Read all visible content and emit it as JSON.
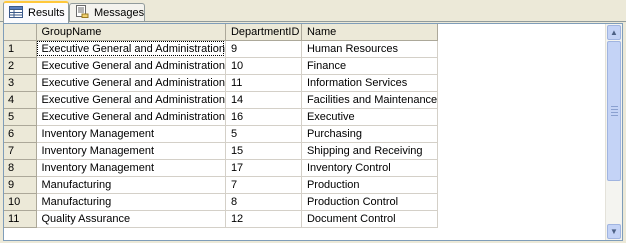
{
  "tabs": [
    {
      "label": "Results",
      "icon": "grid-icon",
      "active": true
    },
    {
      "label": "Messages",
      "icon": "document-icon",
      "active": false
    }
  ],
  "columns": [
    "GroupName",
    "DepartmentID",
    "Name"
  ],
  "rows": [
    {
      "num": "1",
      "group": "Executive General and Administration",
      "id": "9",
      "name": "Human Resources"
    },
    {
      "num": "2",
      "group": "Executive General and Administration",
      "id": "10",
      "name": "Finance"
    },
    {
      "num": "3",
      "group": "Executive General and Administration",
      "id": "11",
      "name": "Information Services"
    },
    {
      "num": "4",
      "group": "Executive General and Administration",
      "id": "14",
      "name": "Facilities and Maintenance"
    },
    {
      "num": "5",
      "group": "Executive General and Administration",
      "id": "16",
      "name": "Executive"
    },
    {
      "num": "6",
      "group": "Inventory Management",
      "id": "5",
      "name": "Purchasing"
    },
    {
      "num": "7",
      "group": "Inventory Management",
      "id": "15",
      "name": "Shipping and Receiving"
    },
    {
      "num": "8",
      "group": "Inventory Management",
      "id": "17",
      "name": "Inventory Control"
    },
    {
      "num": "9",
      "group": "Manufacturing",
      "id": "7",
      "name": "Production"
    },
    {
      "num": "10",
      "group": "Manufacturing",
      "id": "8",
      "name": "Production Control"
    },
    {
      "num": "11",
      "group": "Quality Assurance",
      "id": "12",
      "name": "Document Control"
    }
  ],
  "colors": {
    "header_bg": "#ece9d8",
    "active_tab_accent": "#ffc83c",
    "grid_line": "#d4d0c8"
  }
}
